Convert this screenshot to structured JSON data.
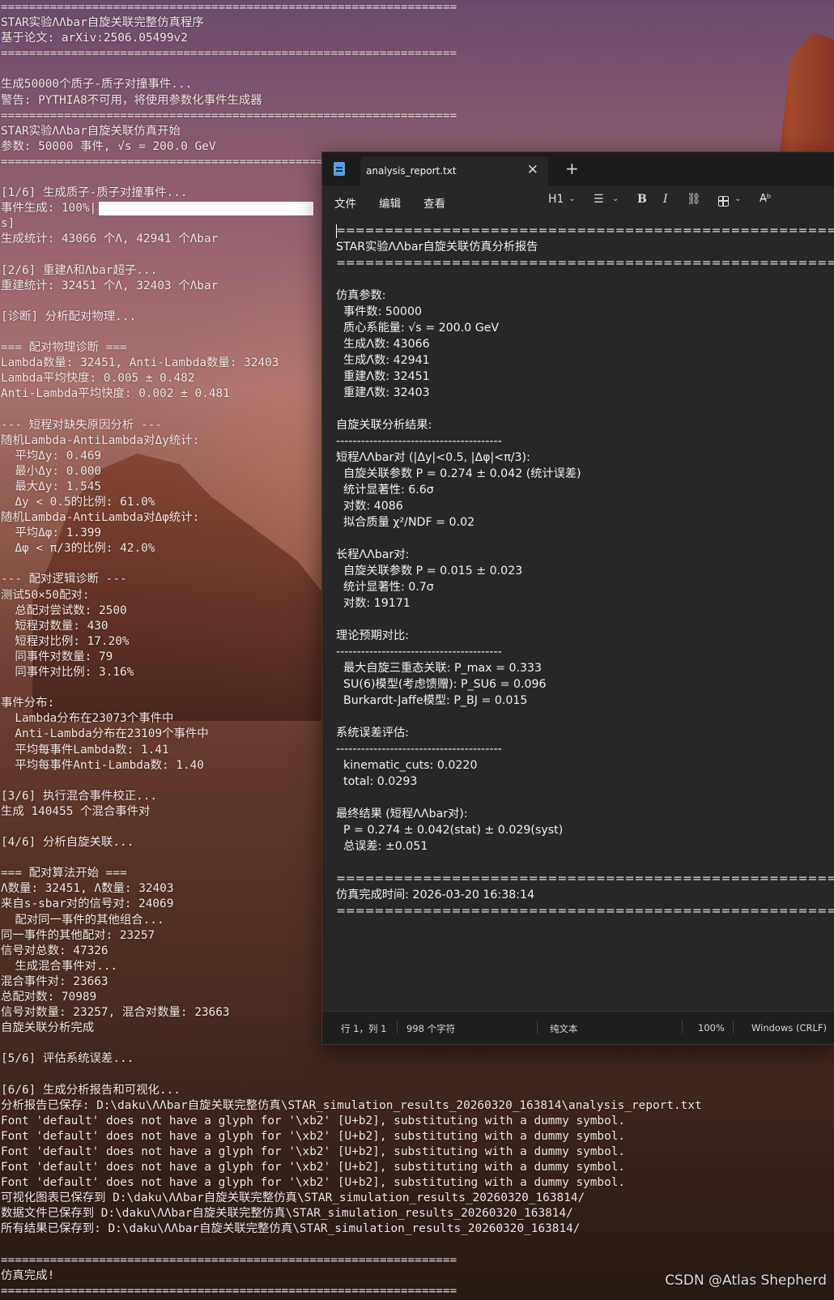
{
  "console": {
    "lines": [
      "=================================================================",
      "STAR实验ΛΛbar自旋关联完整仿真程序",
      "基于论文: arXiv:2506.05499v2",
      "=================================================================",
      "",
      "生成50000个质子-质子对撞事件...",
      "警告: PYTHIA8不可用，将使用参数化事件生成器",
      "=================================================================",
      "STAR实验ΛΛbar自旋关联仿真开始",
      "参数: 50000 事件, √s = 200.0 GeV",
      "=================================================================",
      "",
      "[1/6] 生成质子-质子对撞事件...",
      "__PROGRESS__",
      "s]",
      "生成统计: 43066 个Λ, 42941 个Λbar",
      "",
      "[2/6] 重建Λ和Λbar超子...",
      "重建统计: 32451 个Λ, 32403 个Λbar",
      "",
      "[诊断] 分析配对物理...",
      "",
      "=== 配对物理诊断 ===",
      "Lambda数量: 32451, Anti-Lambda数量: 32403",
      "Lambda平均快度: 0.005 ± 0.482",
      "Anti-Lambda平均快度: 0.002 ± 0.481",
      "",
      "--- 短程对缺失原因分析 ---",
      "随机Lambda-AntiLambda对Δy统计:",
      "  平均Δy: 0.469",
      "  最小Δy: 0.000",
      "  最大Δy: 1.545",
      "  Δy < 0.5的比例: 61.0%",
      "随机Lambda-AntiLambda对Δφ统计:",
      "  平均Δφ: 1.399",
      "  Δφ < π/3的比例: 42.0%",
      "",
      "--- 配对逻辑诊断 ---",
      "测试50×50配对:",
      "  总配对尝试数: 2500",
      "  短程对数量: 430",
      "  短程对比例: 17.20%",
      "  同事件对数量: 79",
      "  同事件对比例: 3.16%",
      "",
      "事件分布:",
      "  Lambda分布在23073个事件中",
      "  Anti-Lambda分布在23109个事件中",
      "  平均每事件Lambda数: 1.41",
      "  平均每事件Anti-Lambda数: 1.40",
      "",
      "[3/6] 执行混合事件校正...",
      "生成 140455 个混合事件对",
      "",
      "[4/6] 分析自旋关联...",
      "",
      "=== 配对算法开始 ===",
      "Λ数量: 32451, Λ̄数量: 32403",
      "来自s-sbar对的信号对: 24069",
      "  配对同一事件的其他组合...",
      "同一事件的其他配对: 23257",
      "信号对总数: 47326",
      "  生成混合事件对...",
      "混合事件对: 23663",
      "总配对数: 70989",
      "信号对数量: 23257, 混合对数量: 23663",
      "自旋关联分析完成",
      "",
      "[5/6] 评估系统误差...",
      "",
      "[6/6] 生成分析报告和可视化...",
      "分析报告已保存: D:\\daku\\ΛΛbar自旋关联完整仿真\\STAR_simulation_results_20260320_163814\\analysis_report.txt",
      "Font 'default' does not have a glyph for '\\xb2' [U+b2], substituting with a dummy symbol.",
      "Font 'default' does not have a glyph for '\\xb2' [U+b2], substituting with a dummy symbol.",
      "Font 'default' does not have a glyph for '\\xb2' [U+b2], substituting with a dummy symbol.",
      "Font 'default' does not have a glyph for '\\xb2' [U+b2], substituting with a dummy symbol.",
      "Font 'default' does not have a glyph for '\\xb2' [U+b2], substituting with a dummy symbol.",
      "可视化图表已保存到 D:\\daku\\ΛΛbar自旋关联完整仿真\\STAR_simulation_results_20260320_163814/",
      "数据文件已保存到 D:\\daku\\ΛΛbar自旋关联完整仿真\\STAR_simulation_results_20260320_163814/",
      "所有结果已保存到: D:\\daku\\ΛΛbar自旋关联完整仿真\\STAR_simulation_results_20260320_163814/",
      "",
      "=================================================================",
      "仿真完成!",
      "================================================================="
    ],
    "progress": {
      "label": "事件生成: 100%|",
      "fraction": 1.0
    }
  },
  "notepad": {
    "tab_title": "analysis_report.txt",
    "menu": [
      "文件",
      "编辑",
      "查看"
    ],
    "toolbar": {
      "heading": "H1"
    },
    "document_lines": [
      "============================================================",
      "STAR实验ΛΛbar自旋关联仿真分析报告",
      "============================================================",
      "",
      "仿真参数:",
      "  事件数: 50000",
      "  质心系能量: √s = 200.0 GeV",
      "  生成Λ数: 43066",
      "  生成Λ̄数: 42941",
      "  重建Λ数: 32451",
      "  重建Λ̄数: 32403",
      "",
      "自旋关联分析结果:",
      "----------------------------------------",
      "短程ΛΛbar对 (|Δy|<0.5, |Δφ|<π/3):",
      "  自旋关联参数 P = 0.274 ± 0.042 (统计误差)",
      "  统计显著性: 6.6σ",
      "  对数: 4086",
      "  拟合质量 χ²/NDF = 0.02",
      "",
      "长程ΛΛbar对:",
      "  自旋关联参数 P = 0.015 ± 0.023",
      "  统计显著性: 0.7σ",
      "  对数: 19171",
      "",
      "理论预期对比:",
      "----------------------------------------",
      "  最大自旋三重态关联: P_max = 0.333",
      "  SU(6)模型(考虑馈赠): P_SU6 = 0.096",
      "  Burkardt-Jaffe模型: P_BJ = 0.015",
      "",
      "系统误差评估:",
      "----------------------------------------",
      "  kinematic_cuts: 0.0220",
      "  total: 0.0293",
      "",
      "最终结果 (短程ΛΛbar对):",
      "  P = 0.274 ± 0.042(stat) ± 0.029(syst)",
      "  总误差: ±0.051",
      "",
      "============================================================",
      "仿真完成时间: 2026-03-20 16:38:14",
      "============================================================"
    ],
    "status": {
      "position": "行 1，列 1",
      "chars": "998 个字符",
      "format": "纯文本",
      "zoom": "100%",
      "line_ending": "Windows (CRLF)"
    }
  },
  "watermark": "CSDN @Atlas Shepherd",
  "colors": {
    "notepad_bg": "#272727",
    "tabbar_bg": "#1c1c1c",
    "console_text": "#f0e6e2",
    "app_icon": "#5aa0ea"
  },
  "icons": [
    "notepad-app-icon",
    "close-icon",
    "plus-icon",
    "chevron-down-icon",
    "bulleted-list-icon",
    "bold-icon",
    "italic-icon",
    "link-icon",
    "table-icon",
    "spellcheck-icon"
  ]
}
